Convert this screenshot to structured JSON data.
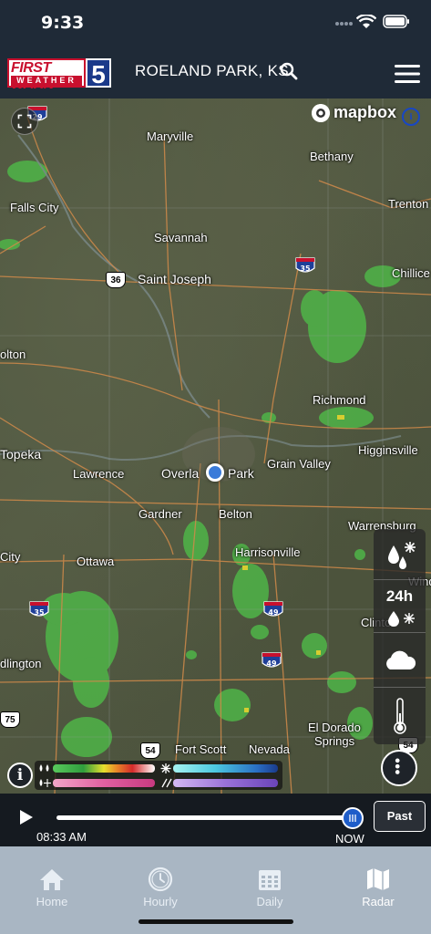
{
  "status_bar": {
    "time": "9:33"
  },
  "header": {
    "logo_text_top": "FIRST WARN",
    "logo_text_bottom": "WEATHER",
    "logo_number": "5",
    "location": "ROELAND PARK, KS"
  },
  "map": {
    "attribution": "mapbox",
    "cities": [
      "Maryville",
      "Bethany",
      "Falls City",
      "Trenton",
      "Savannah",
      "Saint Joseph",
      "Chillice",
      "olton",
      "Richmond",
      "Higginsville",
      "Topeka",
      "Lawrence",
      "Overla",
      "Park",
      "Grain Valley",
      "Gardner",
      "Belton",
      "Warrensburg",
      "City",
      "Ottawa",
      "Harrisonville",
      "Wind",
      "Clinton",
      "dlington",
      "El Dorado",
      "Springs",
      "Fort Scott",
      "Nevada"
    ],
    "highway_shields": [
      "29",
      "36",
      "35",
      "35",
      "49",
      "49",
      "75",
      "54",
      "54"
    ]
  },
  "layers": {
    "precip_label": "",
    "snow24_label": "24h",
    "clouds_label": "",
    "temp_label": ""
  },
  "legend": {
    "info_label": "i"
  },
  "timeline": {
    "start_time": "08:33 AM",
    "end_label": "NOW",
    "past_button": "Past",
    "progress": 1.0
  },
  "tabs": [
    {
      "label": "Home",
      "icon": "home-icon"
    },
    {
      "label": "Hourly",
      "icon": "clock-icon"
    },
    {
      "label": "Daily",
      "icon": "calendar-icon"
    },
    {
      "label": "Radar",
      "icon": "map-icon",
      "active": true
    }
  ],
  "colors": {
    "header_bg": "#1f2a37",
    "tabbar_bg": "#a9b6c3",
    "brand_red": "#c8102e",
    "brand_blue": "#1b3a8a",
    "accent_blue": "#1e5dc9"
  }
}
